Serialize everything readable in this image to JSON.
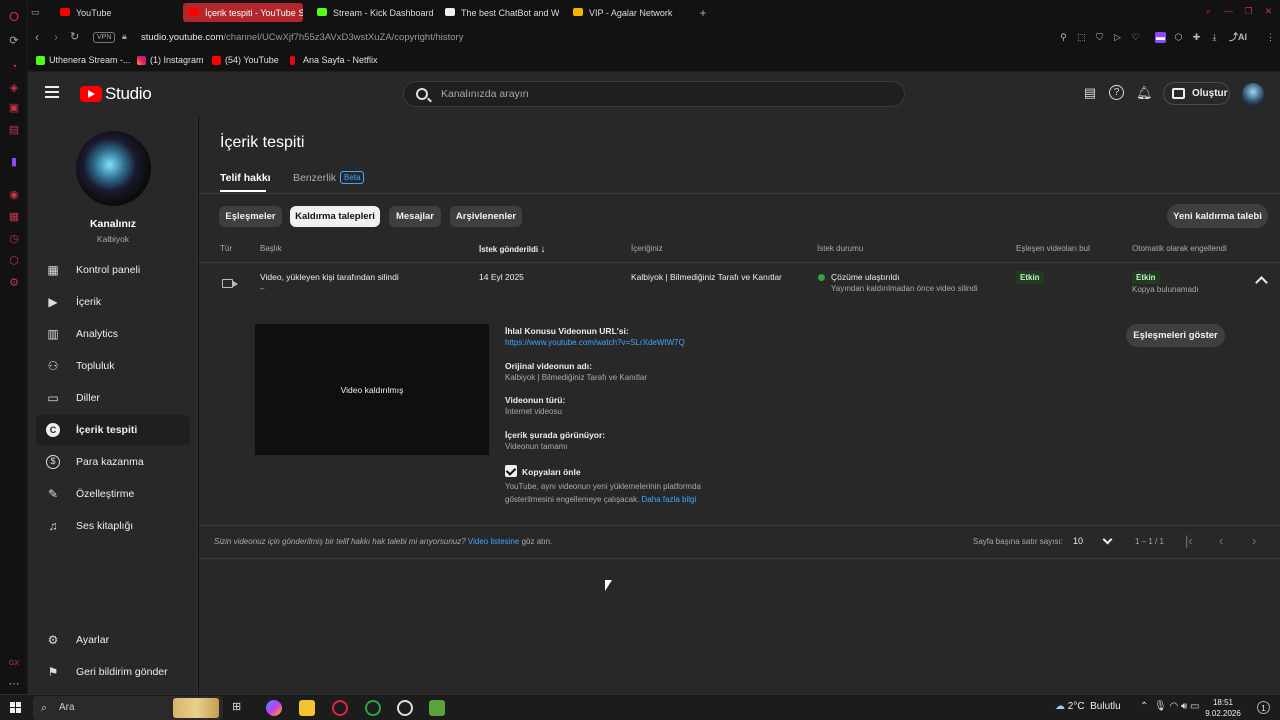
{
  "browser": {
    "tabs": [
      {
        "label": "YouTube",
        "active": false
      },
      {
        "label": "İçerik tespiti - YouTube St",
        "active": true
      },
      {
        "label": "Stream - Kick Dashboard",
        "active": false
      },
      {
        "label": "The best ChatBot and Wid",
        "active": false
      },
      {
        "label": "VIP - Agalar Network",
        "active": false
      }
    ],
    "new_tab": "+",
    "vpn": "VPN",
    "url_host": "studio.youtube.com",
    "url_path": "/channel/UCwXjf7h55z3AVxD3wstXuZA/copyright/history",
    "ai_label": "AI",
    "bookmarks": [
      "Uthenera Stream -...",
      "(1) Instagram",
      "(54) YouTube",
      "Ana Sayfa - Netflix"
    ]
  },
  "header": {
    "logo_text": "Studio",
    "search_placeholder": "Kanalınızda arayın",
    "create_label": "Oluştur"
  },
  "sidebar": {
    "channel_name": "Kanalınız",
    "channel_handle": "Kalbiyok",
    "items": [
      {
        "label": "Kontrol paneli",
        "icon": "dashboard-icon"
      },
      {
        "label": "İçerik",
        "icon": "content-icon"
      },
      {
        "label": "Analytics",
        "icon": "analytics-icon"
      },
      {
        "label": "Topluluk",
        "icon": "community-icon"
      },
      {
        "label": "Diller",
        "icon": "subtitles-icon"
      },
      {
        "label": "İçerik tespiti",
        "icon": "copyright-icon",
        "selected": true
      },
      {
        "label": "Para kazanma",
        "icon": "dollar-icon"
      },
      {
        "label": "Özelleştirme",
        "icon": "customize-icon"
      },
      {
        "label": "Ses kitaplığı",
        "icon": "audio-library-icon"
      }
    ],
    "bottom": [
      {
        "label": "Ayarlar",
        "icon": "gear-icon"
      },
      {
        "label": "Geri bildirim gönder",
        "icon": "feedback-icon"
      }
    ]
  },
  "main": {
    "title": "İçerik tespiti",
    "tabs": [
      {
        "label": "Telif hakkı"
      },
      {
        "label": "Benzerlik"
      }
    ],
    "beta": "Beta",
    "chips": [
      "Eşleşmeler",
      "Kaldırma talepleri",
      "Mesajlar",
      "Arşivlenenler"
    ],
    "new_request": "Yeni kaldırma talebi",
    "columns": [
      "Tür",
      "Başlık",
      "İstek gönderildi",
      "İçeriğiniz",
      "İstek durumu",
      "Eşleşen videoları bul",
      "Otomatik olarak engellendi"
    ],
    "row": {
      "title": "Video, yükleyen kişi tarafından silindi",
      "title_sub": "–",
      "date": "14 Eyl 2025",
      "content": "Kalbiyok | Bilmediğiniz Tarafı ve Kanıtlar",
      "status": "Çözüme ulaştırıldı",
      "status_sub": "Yayından kaldırılmadan önce video silindi",
      "find_badge": "Etkin",
      "auto_badge": "Etkin",
      "auto_sub": "Kopya bulunamadı"
    },
    "detail": {
      "thumb_text": "Video kaldırılmış",
      "url_label": "İhlal Konusu Videonun URL'si:",
      "url_value": "https://www.youtube.com/watch?v=SLrXdeWtW7Q",
      "orig_label": "Orijinal videonun adı:",
      "orig_value": "Kalbiyok | Bilmediğiniz Tarafı ve Kanıtlar",
      "type_label": "Videonun türü:",
      "type_value": "İnternet videosu",
      "where_label": "İçerik şurada görünüyor:",
      "where_value": "Videonun tamamı",
      "show_matches": "Eşleşmeleri göster",
      "prevent_label": "Kopyaları önle",
      "prevent_checked": true,
      "prevent_desc1": "YouTube, aynı videonun yeni yüklemelerinin platformda",
      "prevent_desc2": "gösterilmesini engellemeye çalışacak.",
      "learn_more": "Daha fazla bilgi"
    },
    "footer": {
      "text_before": "Sizin videonuz için gönderilmiş bir telif hakkı hak talebi mi arıyorsunuz?",
      "link": "Video listesine",
      "text_after": "göz atın.",
      "rows_label": "Sayfa başına satır sayısı:",
      "rows_value": "10",
      "range": "1 – 1 / 1"
    }
  },
  "taskbar": {
    "search_label": "Ara",
    "temp": "2°C",
    "weather": "Bulutlu",
    "time": "18:51",
    "date": "9.02.2026",
    "notification_count": "1"
  }
}
